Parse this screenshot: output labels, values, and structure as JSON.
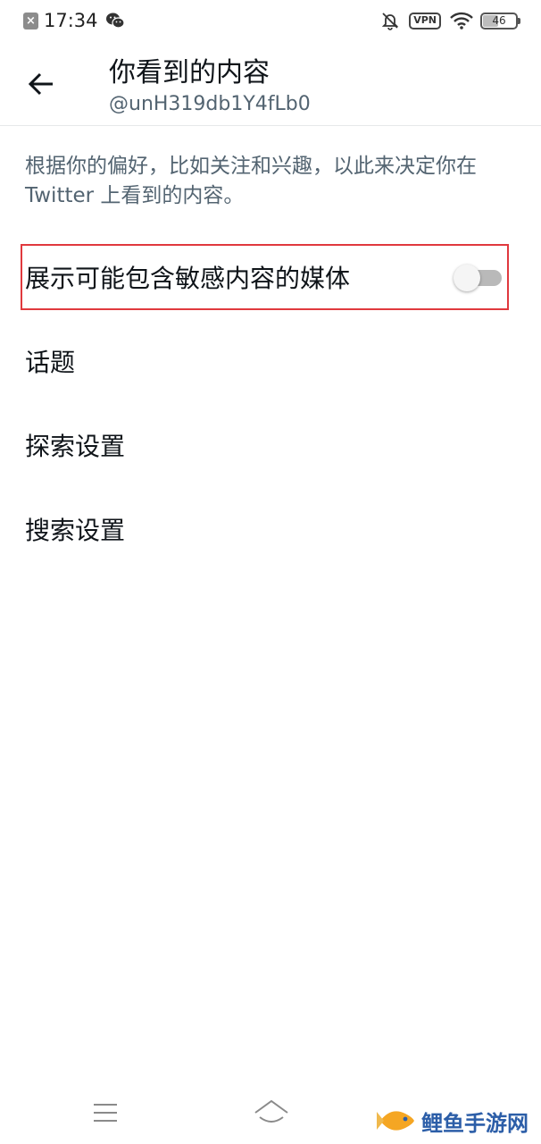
{
  "status_bar": {
    "time": "17:34",
    "vpn": "VPN",
    "battery": "46",
    "battery_level": 0.46
  },
  "header": {
    "title": "你看到的内容",
    "subtitle": "@unH319db1Y4fLb0"
  },
  "description": "根据你的偏好，比如关注和兴趣，以此来决定你在 Twitter 上看到的内容。",
  "settings": {
    "sensitive_media": {
      "label": "展示可能包含敏感内容的媒体",
      "enabled": false
    },
    "topics": "话题",
    "explore": "探索设置",
    "search": "搜索设置"
  },
  "watermark": {
    "text": "鲤鱼手游网"
  },
  "colors": {
    "highlight_border": "#e0393e",
    "secondary_text": "#536471",
    "primary_text": "#0f1419",
    "watermark": "#2c5ea8"
  }
}
